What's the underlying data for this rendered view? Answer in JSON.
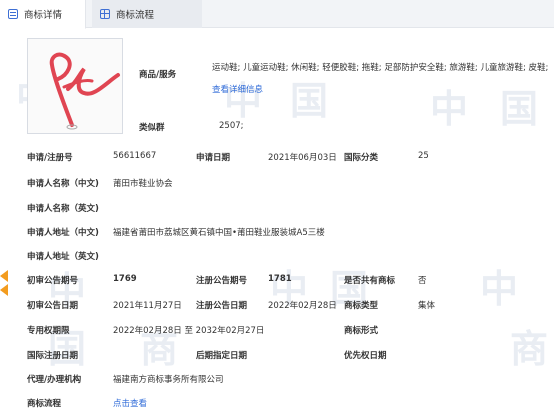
{
  "tabs": {
    "detail": "商标详情",
    "flow": "商标流程"
  },
  "watermark_chars": [
    "中",
    "国",
    "商",
    "标"
  ],
  "logo": {
    "description_icon": "handwritten-signature-logo"
  },
  "goods": {
    "label": "商品/服务",
    "text": "运动鞋; 儿童运动鞋; 休闲鞋; 轻便胶鞋; 拖鞋; 足部防护安全鞋; 旅游鞋; 儿童旅游鞋; 皮鞋;",
    "link": "查看详细信息"
  },
  "similar_group": {
    "label": "类似群",
    "value": "2507;"
  },
  "application_no": {
    "label": "申请/注册号",
    "value": "56611667"
  },
  "application_date": {
    "label": "申请日期",
    "value": "2021年06月03日"
  },
  "intl_class": {
    "label": "国际分类",
    "value": "25"
  },
  "applicant_cn": {
    "label": "申请人名称（中文)",
    "value": "莆田市鞋业协会"
  },
  "applicant_en": {
    "label": "申请人名称（英文)",
    "value": ""
  },
  "address_cn": {
    "label": "申请人地址（中文)",
    "value": "福建省莆田市荔城区黄石镇中国•莆田鞋业服装城A5三楼"
  },
  "address_en": {
    "label": "申请人地址（英文)",
    "value": ""
  },
  "prelim_pub_no": {
    "label": "初审公告期号",
    "value": "1769"
  },
  "reg_pub_no": {
    "label": "注册公告期号",
    "value": "1781"
  },
  "shared": {
    "label": "是否共有商标",
    "value": "否"
  },
  "prelim_pub_date": {
    "label": "初审公告日期",
    "value": "2021年11月27日"
  },
  "reg_pub_date": {
    "label": "注册公告日期",
    "value": "2022年02月28日"
  },
  "mark_type": {
    "label": "商标类型",
    "value": "集体"
  },
  "exclusive_period": {
    "label": "专用权期限",
    "value": "2022年02月28日 至 2032年02月27日"
  },
  "mark_form": {
    "label": "商标形式",
    "value": ""
  },
  "intl_reg_date": {
    "label": "国际注册日期",
    "value": ""
  },
  "later_designation": {
    "label": "后期指定日期",
    "value": ""
  },
  "priority_date": {
    "label": "优先权日期",
    "value": ""
  },
  "agent": {
    "label": "代理/办理机构",
    "value": "福建南方商标事务所有限公司"
  },
  "flow": {
    "label": "商标流程",
    "link": "点击查看"
  },
  "colors": {
    "accent": "#2f6bd8",
    "logo_red": "#e04552",
    "arrow": "#f39c1f"
  }
}
